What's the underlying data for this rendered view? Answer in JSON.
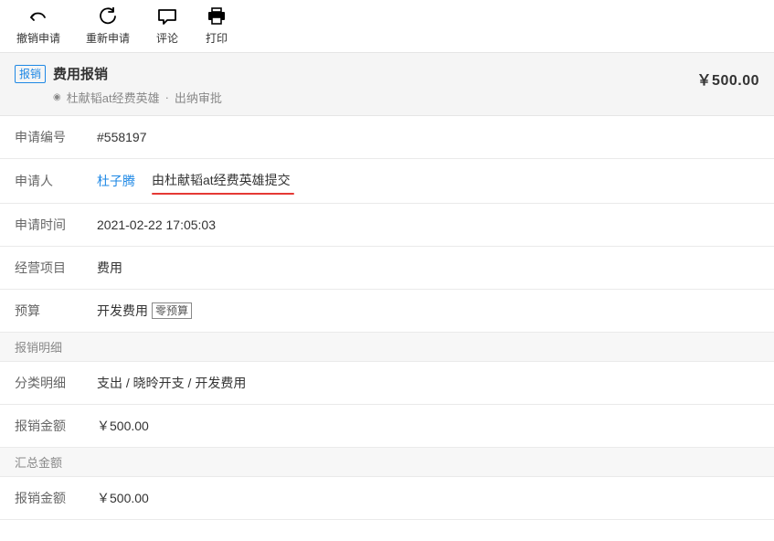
{
  "toolbar": {
    "withdraw": "撤销申请",
    "resubmit": "重新申请",
    "comment": "评论",
    "print": "打印"
  },
  "header": {
    "tag": "报销",
    "title": "费用报销",
    "submitter": "杜献韬at经费英雄",
    "separator": "·",
    "status": "出纳审批",
    "amount": "￥500.00"
  },
  "fields": {
    "request_no_label": "申请编号",
    "request_no": "#558197",
    "applicant_label": "申请人",
    "applicant_name": "杜子腾",
    "applicant_note": "由杜献韬at经费英雄提交",
    "time_label": "申请时间",
    "time": "2021-02-22 17:05:03",
    "project_label": "经营项目",
    "project": "费用",
    "budget_label": "预算",
    "budget_value": "开发费用",
    "budget_chip": "零预算"
  },
  "sections": {
    "detail_title": "报销明细",
    "category_label": "分类明细",
    "category_value": "支出 / 晓昤开支 / 开发费用",
    "amount_label": "报销金额",
    "amount_value": "￥500.00",
    "summary_title": "汇总金额",
    "summary_amount_label": "报销金额",
    "summary_amount_value": "￥500.00"
  }
}
